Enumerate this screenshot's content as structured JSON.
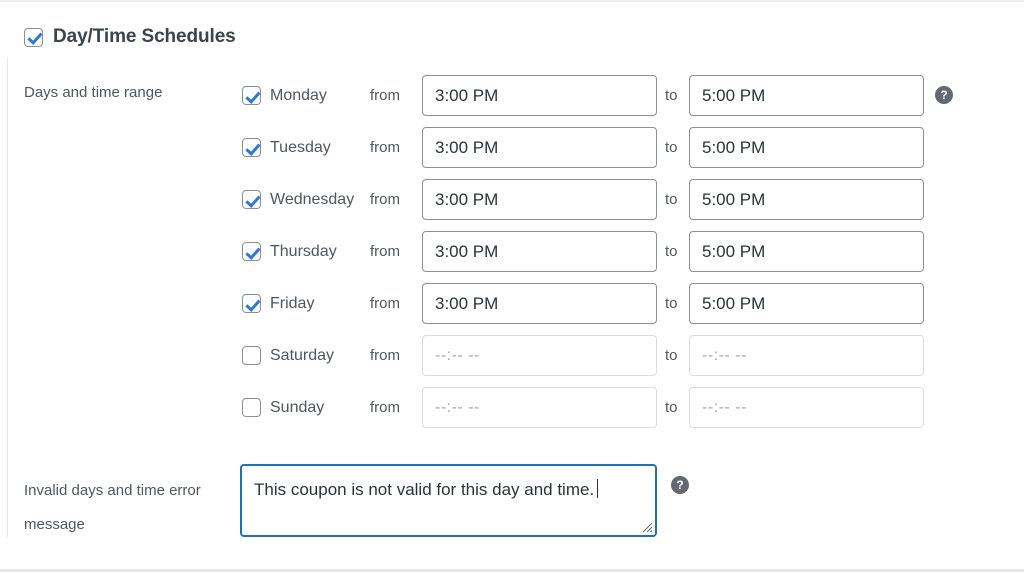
{
  "section": {
    "title": "Day/Time Schedules",
    "enabled": true,
    "checkbox_name": "day-time-schedules-toggle"
  },
  "days_field": {
    "label": "Days and time range",
    "from_label": "from",
    "to_label": "to",
    "time_placeholder": "--:-- --",
    "help_icon": "help-icon",
    "rows": [
      {
        "day": "Monday",
        "checked": true,
        "from": "3:00 PM",
        "to": "5:00 PM"
      },
      {
        "day": "Tuesday",
        "checked": true,
        "from": "3:00 PM",
        "to": "5:00 PM"
      },
      {
        "day": "Wednesday",
        "checked": true,
        "from": "3:00 PM",
        "to": "5:00 PM"
      },
      {
        "day": "Thursday",
        "checked": true,
        "from": "3:00 PM",
        "to": "5:00 PM"
      },
      {
        "day": "Friday",
        "checked": true,
        "from": "3:00 PM",
        "to": "5:00 PM"
      },
      {
        "day": "Saturday",
        "checked": false,
        "from": "",
        "to": ""
      },
      {
        "day": "Sunday",
        "checked": false,
        "from": "",
        "to": ""
      }
    ]
  },
  "error_message_field": {
    "label": "Invalid days and time error message",
    "value": "This coupon is not valid for this day and time.",
    "focused": true,
    "help_icon": "help-icon"
  },
  "colors": {
    "accent_blue": "#2271b1",
    "check_blue": "#2a7ade",
    "text": "#50575e",
    "input_border": "#8c8f94",
    "disabled_border": "#dcdcde",
    "placeholder_text": "#a7aaad",
    "help_bg": "#646970"
  }
}
